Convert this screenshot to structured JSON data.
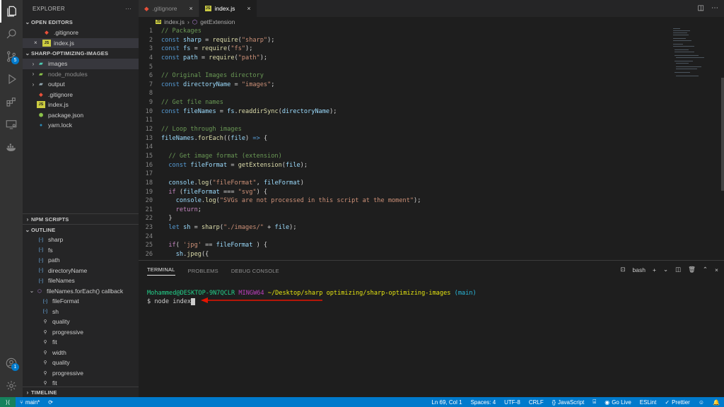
{
  "colors": {
    "accent": "#007acc",
    "statusbar": "#007acc",
    "arrow": "#e51400"
  },
  "activity": {
    "badge_scm": "5",
    "badge_account": "1"
  },
  "sidebar": {
    "title": "EXPLORER",
    "more": "···",
    "open_editors": {
      "header": "OPEN EDITORS",
      "items": [
        {
          "name": ".gitignore"
        },
        {
          "name": "index.js"
        }
      ]
    },
    "project": {
      "header": "SHARP-OPTIMIZING-IMAGES",
      "items": [
        {
          "name": "images",
          "type": "folder"
        },
        {
          "name": "node_modules",
          "type": "folder"
        },
        {
          "name": "output",
          "type": "folder"
        },
        {
          "name": ".gitignore",
          "type": "git"
        },
        {
          "name": "index.js",
          "type": "js"
        },
        {
          "name": "package.json",
          "type": "json"
        },
        {
          "name": "yarn.lock",
          "type": "yarn"
        }
      ]
    },
    "npm_header": "NPM SCRIPTS",
    "outline": {
      "header": "OUTLINE",
      "items": [
        {
          "name": "sharp",
          "kind": "var"
        },
        {
          "name": "fs",
          "kind": "var"
        },
        {
          "name": "path",
          "kind": "var"
        },
        {
          "name": "directoryName",
          "kind": "var"
        },
        {
          "name": "fileNames",
          "kind": "var"
        },
        {
          "name": "fileNames.forEach() callback",
          "kind": "fn"
        },
        {
          "name": "fileFormat",
          "kind": "var"
        },
        {
          "name": "sh",
          "kind": "var"
        },
        {
          "name": "quality",
          "kind": "prop"
        },
        {
          "name": "progressive",
          "kind": "prop"
        },
        {
          "name": "fit",
          "kind": "prop"
        },
        {
          "name": "width",
          "kind": "prop"
        },
        {
          "name": "quality",
          "kind": "prop"
        },
        {
          "name": "progressive",
          "kind": "prop"
        },
        {
          "name": "fit",
          "kind": "prop"
        }
      ]
    },
    "timeline_header": "TIMELINE"
  },
  "tabs": [
    {
      "name": ".gitignore",
      "close": "×"
    },
    {
      "name": "index.js",
      "close": "×"
    }
  ],
  "breadcrumb": {
    "file": "index.js",
    "sep": "›",
    "symbol": "getExtension"
  },
  "code_lines": [
    [
      [
        "c-com",
        "// Packages"
      ]
    ],
    [
      [
        "c-kw",
        "const "
      ],
      [
        "c-var",
        "sharp"
      ],
      [
        "c-pun",
        " = "
      ],
      [
        "c-fn",
        "require"
      ],
      [
        "c-pun",
        "("
      ],
      [
        "c-str",
        "\"sharp\""
      ],
      [
        "c-pun",
        ");"
      ]
    ],
    [
      [
        "c-kw",
        "const "
      ],
      [
        "c-var",
        "fs"
      ],
      [
        "c-pun",
        " = "
      ],
      [
        "c-fn",
        "require"
      ],
      [
        "c-pun",
        "("
      ],
      [
        "c-str",
        "\"fs\""
      ],
      [
        "c-pun",
        ");"
      ]
    ],
    [
      [
        "c-kw",
        "const "
      ],
      [
        "c-var",
        "path"
      ],
      [
        "c-pun",
        " = "
      ],
      [
        "c-fn",
        "require"
      ],
      [
        "c-pun",
        "("
      ],
      [
        "c-str",
        "\"path\""
      ],
      [
        "c-pun",
        ");"
      ]
    ],
    [],
    [
      [
        "c-com",
        "// Original Images directory"
      ]
    ],
    [
      [
        "c-kw",
        "const "
      ],
      [
        "c-var",
        "directoryName"
      ],
      [
        "c-pun",
        " = "
      ],
      [
        "c-str",
        "\"images\""
      ],
      [
        "c-pun",
        ";"
      ]
    ],
    [],
    [
      [
        "c-com",
        "// Get file names"
      ]
    ],
    [
      [
        "c-kw",
        "const "
      ],
      [
        "c-var",
        "fileNames"
      ],
      [
        "c-pun",
        " = "
      ],
      [
        "c-var",
        "fs"
      ],
      [
        "c-pun",
        "."
      ],
      [
        "c-fn",
        "readdirSync"
      ],
      [
        "c-pun",
        "("
      ],
      [
        "c-var",
        "directoryName"
      ],
      [
        "c-pun",
        ");"
      ]
    ],
    [],
    [
      [
        "c-com",
        "// Loop through images"
      ]
    ],
    [
      [
        "c-var",
        "fileNames"
      ],
      [
        "c-pun",
        "."
      ],
      [
        "c-fn",
        "forEach"
      ],
      [
        "c-pun",
        "(("
      ],
      [
        "c-var",
        "file"
      ],
      [
        "c-pun",
        ") "
      ],
      [
        "c-kw",
        "=>"
      ],
      [
        "c-pun",
        " {"
      ]
    ],
    [],
    [
      [
        "c-pun",
        "  "
      ],
      [
        "c-com",
        "// Get image format (extension)"
      ]
    ],
    [
      [
        "c-pun",
        "  "
      ],
      [
        "c-kw",
        "const "
      ],
      [
        "c-var",
        "fileFormat"
      ],
      [
        "c-pun",
        " = "
      ],
      [
        "c-fn",
        "getExtension"
      ],
      [
        "c-pun",
        "("
      ],
      [
        "c-var",
        "file"
      ],
      [
        "c-pun",
        ");"
      ]
    ],
    [],
    [
      [
        "c-pun",
        "  "
      ],
      [
        "c-var",
        "console"
      ],
      [
        "c-pun",
        "."
      ],
      [
        "c-fn",
        "log"
      ],
      [
        "c-pun",
        "("
      ],
      [
        "c-str",
        "\"fileFormat\""
      ],
      [
        "c-pun",
        ", "
      ],
      [
        "c-var",
        "fileFormat"
      ],
      [
        "c-pun",
        ")"
      ]
    ],
    [
      [
        "c-pun",
        "  "
      ],
      [
        "c-ctl",
        "if"
      ],
      [
        "c-pun",
        " ("
      ],
      [
        "c-var",
        "fileFormat"
      ],
      [
        "c-pun",
        " === "
      ],
      [
        "c-str",
        "\"svg\""
      ],
      [
        "c-pun",
        ") {"
      ]
    ],
    [
      [
        "c-pun",
        "    "
      ],
      [
        "c-var",
        "console"
      ],
      [
        "c-pun",
        "."
      ],
      [
        "c-fn",
        "log"
      ],
      [
        "c-pun",
        "("
      ],
      [
        "c-str",
        "\"SVGs are not processed in this script at the moment\""
      ],
      [
        "c-pun",
        ");"
      ]
    ],
    [
      [
        "c-pun",
        "    "
      ],
      [
        "c-ctl",
        "return"
      ],
      [
        "c-pun",
        ";"
      ]
    ],
    [
      [
        "c-pun",
        "  }"
      ]
    ],
    [
      [
        "c-pun",
        "  "
      ],
      [
        "c-kw",
        "let "
      ],
      [
        "c-var",
        "sh"
      ],
      [
        "c-pun",
        " = "
      ],
      [
        "c-fn",
        "sharp"
      ],
      [
        "c-pun",
        "("
      ],
      [
        "c-str",
        "\"./images/\""
      ],
      [
        "c-pun",
        " + "
      ],
      [
        "c-var",
        "file"
      ],
      [
        "c-pun",
        ");"
      ]
    ],
    [],
    [
      [
        "c-pun",
        "  "
      ],
      [
        "c-ctl",
        "if"
      ],
      [
        "c-pun",
        "( "
      ],
      [
        "c-str",
        "'jpg'"
      ],
      [
        "c-pun",
        " == "
      ],
      [
        "c-var",
        "fileFormat"
      ],
      [
        "c-pun",
        " ) {"
      ]
    ],
    [
      [
        "c-pun",
        "    "
      ],
      [
        "c-var",
        "sh"
      ],
      [
        "c-pun",
        "."
      ],
      [
        "c-fn",
        "jpeg"
      ],
      [
        "c-pun",
        "({"
      ]
    ]
  ],
  "panel": {
    "tabs": [
      "TERMINAL",
      "PROBLEMS",
      "DEBUG CONSOLE"
    ],
    "shell": "bash",
    "prompt": {
      "user": "Mohammed@DESKTOP-9N7QCLR",
      "system": "MINGW64",
      "path": "~/Desktop/sharp optimizing/sharp-optimizing-images",
      "branch": "(main)",
      "command": "$ node index"
    }
  },
  "status": {
    "branch": "main*",
    "position": "Ln 69, Col 1",
    "spaces": "Spaces: 4",
    "encoding": "UTF-8",
    "eol": "CRLF",
    "language": "JavaScript",
    "golive": "Go Live",
    "eslint": "ESLint",
    "prettier": "Prettier"
  }
}
